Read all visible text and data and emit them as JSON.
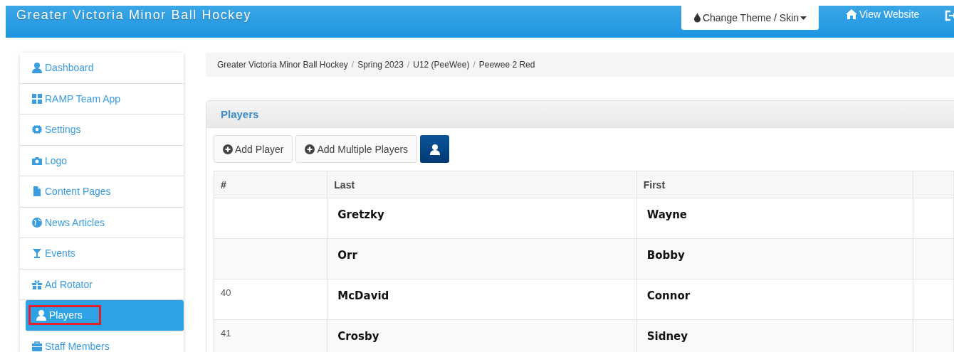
{
  "header": {
    "title": "Greater Victoria Minor Ball Hockey",
    "theme_button": "Change Theme / Skin",
    "view_website": "View Website"
  },
  "sidebar": {
    "items": [
      {
        "label": "Dashboard",
        "selected": false,
        "highlighted": false
      },
      {
        "label": "RAMP Team App",
        "selected": false,
        "highlighted": false
      },
      {
        "label": "Settings",
        "selected": false,
        "highlighted": false
      },
      {
        "label": "Logo",
        "selected": false,
        "highlighted": false
      },
      {
        "label": "Content Pages",
        "selected": false,
        "highlighted": false
      },
      {
        "label": "News Articles",
        "selected": false,
        "highlighted": false
      },
      {
        "label": "Events",
        "selected": false,
        "highlighted": false
      },
      {
        "label": "Ad Rotator",
        "selected": false,
        "highlighted": false
      },
      {
        "label": "Players",
        "selected": true,
        "highlighted": true
      },
      {
        "label": "Staff Members",
        "selected": false,
        "highlighted": false
      }
    ]
  },
  "breadcrumb": {
    "separator": "/",
    "items": [
      "Greater Victoria Minor Ball Hockey",
      "Spring 2023",
      "U12 (PeeWee)",
      "Peewee 2 Red"
    ]
  },
  "panel": {
    "title": "Players",
    "buttons": [
      "Add Player",
      "Add Multiple Players"
    ],
    "table": {
      "columns": [
        "#",
        "Last",
        "First"
      ],
      "rows": [
        {
          "last": "Gretzky",
          "first": "Wayne"
        },
        {
          "last": "Orr",
          "first": "Bobby"
        },
        {
          "number": "40",
          "last": "McDavid",
          "first": "Connor"
        },
        {
          "number": "41",
          "last": "Crosby",
          "first": "Sidney"
        }
      ]
    }
  }
}
